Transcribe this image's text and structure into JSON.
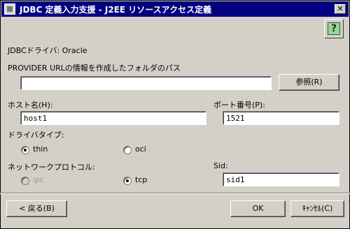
{
  "window": {
    "title": "JDBC 定義入力支援 - J2EE リソースアクセス定義",
    "close_glyph": "✕"
  },
  "help": {
    "glyph": "?"
  },
  "driver": {
    "label": "JDBCドライバ: Oracle"
  },
  "provider": {
    "label": "PROVIDER URLの情報を作成したフォルダのパス",
    "value": "",
    "browse_label": "参照(R)"
  },
  "host": {
    "label": "ホスト名(H):",
    "value": "host1"
  },
  "port": {
    "label": "ポート番号(P):",
    "value": "1521"
  },
  "driver_type": {
    "label": "ドライバタイプ:",
    "options": [
      {
        "label": "thin",
        "checked": true
      },
      {
        "label": "oci",
        "checked": false
      }
    ]
  },
  "protocol": {
    "label": "ネットワークプロトコル:",
    "options": [
      {
        "label": "ipc",
        "checked": false,
        "disabled": true
      },
      {
        "label": "tcp",
        "checked": true
      }
    ]
  },
  "sid": {
    "label": "Sid:",
    "value": "sid1"
  },
  "footer": {
    "back_label": "< 戻る(B)",
    "ok_label": "OK",
    "cancel_label": "ｷｬﾝｾﾙ(C)"
  }
}
